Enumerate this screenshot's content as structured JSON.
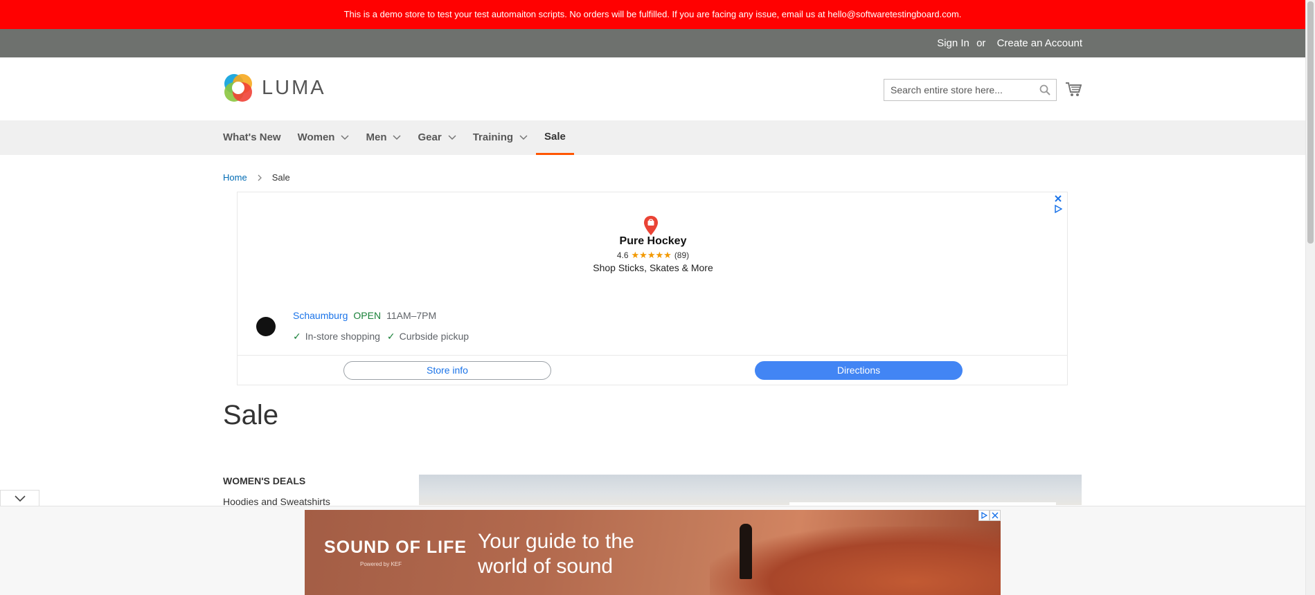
{
  "demo_notice": "This is a demo store to test your test automaiton scripts. No orders will be fulfilled. If you are facing any issue, email us at hello@softwaretestingboard.com.",
  "panel": {
    "sign_in": "Sign In",
    "or": "or",
    "create_account": "Create an Account"
  },
  "logo": {
    "text": "LUMA"
  },
  "search": {
    "placeholder": "Search entire store here..."
  },
  "nav": {
    "items": [
      {
        "label": "What's New",
        "dropdown": false
      },
      {
        "label": "Women",
        "dropdown": true
      },
      {
        "label": "Men",
        "dropdown": true
      },
      {
        "label": "Gear",
        "dropdown": true
      },
      {
        "label": "Training",
        "dropdown": true
      },
      {
        "label": "Sale",
        "dropdown": false,
        "active": true
      }
    ]
  },
  "breadcrumb": {
    "home": "Home",
    "current": "Sale"
  },
  "ad": {
    "name": "Pure Hockey",
    "rating": "4.6",
    "reviews": "(89)",
    "tagline": "Shop Sticks, Skates & More",
    "city": "Schaumburg",
    "status": "OPEN",
    "hours": "11AM–7PM",
    "feature_1": "In-store shopping",
    "feature_2": "Curbside pickup",
    "store_info": "Store info",
    "directions": "Directions"
  },
  "page_title": "Sale",
  "sidebar": {
    "title": "Women's Deals",
    "link_1": "Hoodies and Sweatshirts"
  },
  "bottom_ad": {
    "brand": "SOUND OF LIFE",
    "brand_sub": "Powered by KEF",
    "headline_1": "Your guide to the",
    "headline_2": "world of sound"
  },
  "colors": {
    "demo_bar": "#ff0101",
    "panel": "#6e716e",
    "accent": "#ff5501",
    "link": "#006bb4"
  }
}
